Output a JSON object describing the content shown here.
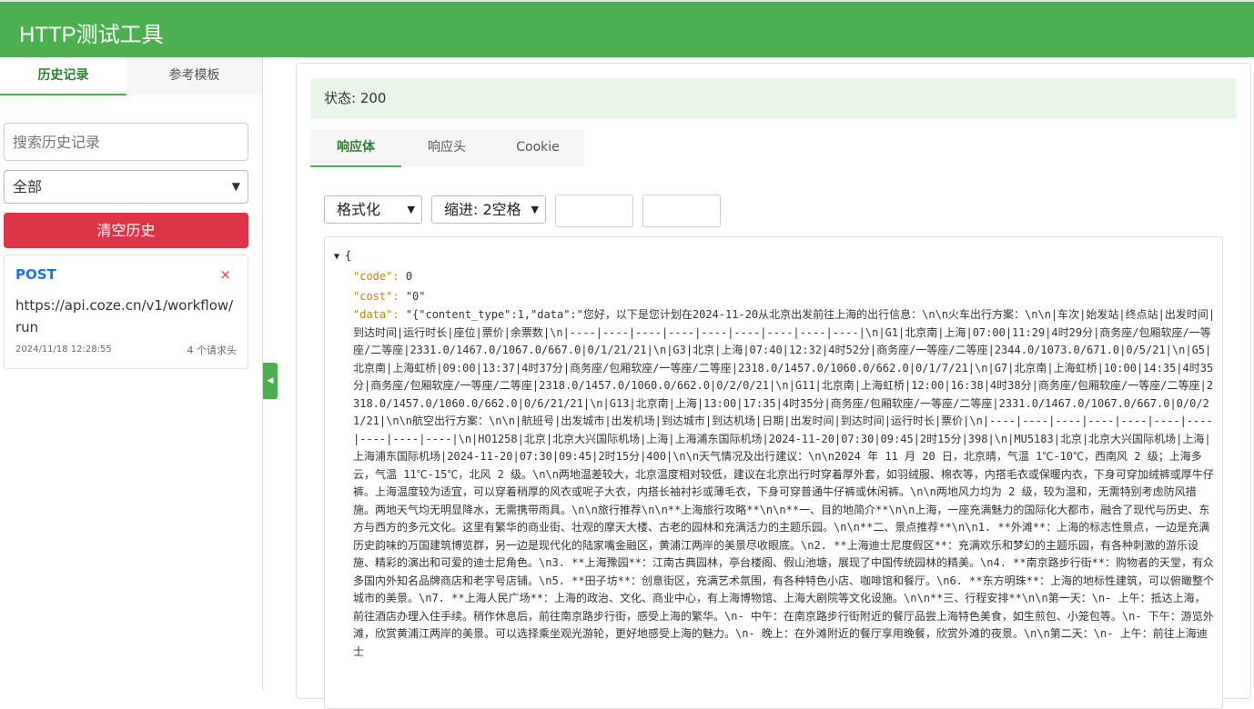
{
  "app": {
    "title": "HTTP测试工具"
  },
  "sidebar": {
    "tabs": [
      {
        "label": "历史记录",
        "active": true
      },
      {
        "label": "参考模板",
        "active": false
      }
    ],
    "search_placeholder": "搜索历史记录",
    "filter_value": "全部",
    "clear_label": "清空历史",
    "history": [
      {
        "method": "POST",
        "url": "https://api.coze.cn/v1/workflow/run",
        "time": "2024/11/18 12:28:55",
        "headers_count": "4 个请求头",
        "close": "×"
      }
    ],
    "collapse_icon": "◀"
  },
  "response": {
    "status_text": "状态: 200",
    "tabs": [
      {
        "label": "响应体",
        "active": true
      },
      {
        "label": "响应头",
        "active": false
      },
      {
        "label": "Cookie",
        "active": false
      }
    ],
    "format_value": "格式化",
    "indent_value": "缩进: 2空格",
    "json": {
      "open_brace": "{",
      "code_key": "\"code\":",
      "code_value": "0",
      "cost_key": "\"cost\":",
      "cost_value": "\"0\"",
      "data_key": "\"data\":",
      "data_value": "\"{\"content_type\":1,\"data\":\"您好，以下是您计划在2024-11-20从北京出发前往上海的出行信息：\\n\\n火车出行方案：\\n\\n|车次|始发站|终点站|出发时间|到达时间|运行时长|座位|票价|余票数|\\n|----|----|----|----|----|----|----|----|----|\\n|G1|北京南|上海|07:00|11:29|4时29分|商务座/包厢软座/一等座/二等座|2331.0/1467.0/1067.0/667.0|0/1/21/21|\\n|G3|北京|上海|07:40|12:32|4时52分|商务座/一等座/二等座|2344.0/1073.0/671.0|0/5/21|\\n|G5|北京南|上海虹桥|09:00|13:37|4时37分|商务座/包厢软座/一等座/二等座|2318.0/1457.0/1060.0/662.0|0/1/7/21|\\n|G7|北京南|上海虹桥|10:00|14:35|4时35分|商务座/包厢软座/一等座/二等座|2318.0/1457.0/1060.0/662.0|0/2/0/21|\\n|G11|北京南|上海虹桥|12:00|16:38|4时38分|商务座/包厢软座/一等座/二等座|2318.0/1457.0/1060.0/662.0|0/6/21/21|\\n|G13|北京南|上海|13:00|17:35|4时35分|商务座/包厢软座/一等座/二等座|2331.0/1467.0/1067.0/667.0|0/0/21/21|\\n\\n航空出行方案：\\n\\n|航班号|出发城市|出发机场|到达城市|到达机场|日期|出发时间|到达时间|运行时长|票价|\\n|----|----|----|----|----|----|----|----|----|----|\\n|HO1258|北京|北京大兴国际机场|上海|上海浦东国际机场|2024-11-20|07:30|09:45|2时15分|398|\\n|MU5183|北京|北京大兴国际机场|上海|上海浦东国际机场|2024-11-20|07:30|09:45|2时15分|400|\\n\\n天气情况及出行建议：\\n\\n2024 年 11 月 20 日，北京晴，气温 1℃-10℃，西南风 2 级；上海多云，气温 11℃-15℃，北风 2 级。\\n\\n两地温差较大，北京温度相对较低，建议在北京出行时穿着厚外套，如羽绒服、棉衣等，内搭毛衣或保暖内衣，下身可穿加绒裤或厚牛仔裤。上海温度较为适宜，可以穿着稍厚的风衣或呢子大衣，内搭长袖衬衫或薄毛衣，下身可穿普通牛仔裤或休闲裤。\\n\\n两地风力均为 2 级，较为温和，无需特别考虑防风措施。两地天气均无明显降水，无需携带雨具。\\n\\n旅行推荐\\n\\n**上海旅行攻略**\\n\\n**一、目的地简介**\\n\\n上海，一座充满魅力的国际化大都市，融合了现代与历史、东方与西方的多元文化。这里有繁华的商业街、壮观的摩天大楼、古老的园林和充满活力的主题乐园。\\n\\n**二、景点推荐**\\n\\n1. **外滩**：上海的标志性景点，一边是充满历史韵味的万国建筑博览群，另一边是现代化的陆家嘴金融区，黄浦江两岸的美景尽收眼底。\\n2. **上海迪士尼度假区**：充满欢乐和梦幻的主题乐园，有各种刺激的游乐设施、精彩的演出和可爱的迪士尼角色。\\n3. **上海豫园**：江南古典园林，亭台楼阁、假山池塘，展现了中国传统园林的精美。\\n4. **南京路步行街**：购物者的天堂，有众多国内外知名品牌商店和老字号店铺。\\n5. **田子坊**：创意街区，充满艺术氛围，有各种特色小店、咖啡馆和餐厅。\\n6. **东方明珠**：上海的地标性建筑，可以俯瞰整个城市的美景。\\n7. **上海人民广场**：上海的政治、文化、商业中心，有上海博物馆、上海大剧院等文化设施。\\n\\n**三、行程安排**\\n\\n第一天：\\n- 上午：抵达上海，前往酒店办理入住手续。稍作休息后，前往南京路步行街，感受上海的繁华。\\n- 中午：在南京路步行街附近的餐厅品尝上海特色美食，如生煎包、小笼包等。\\n- 下午：游览外滩，欣赏黄浦江两岸的美景。可以选择乘坐观光游轮，更好地感受上海的魅力。\\n- 晚上：在外滩附近的餐厅享用晚餐，欣赏外滩的夜景。\\n\\n第二天：\\n- 上午：前往上海迪士"
    }
  }
}
